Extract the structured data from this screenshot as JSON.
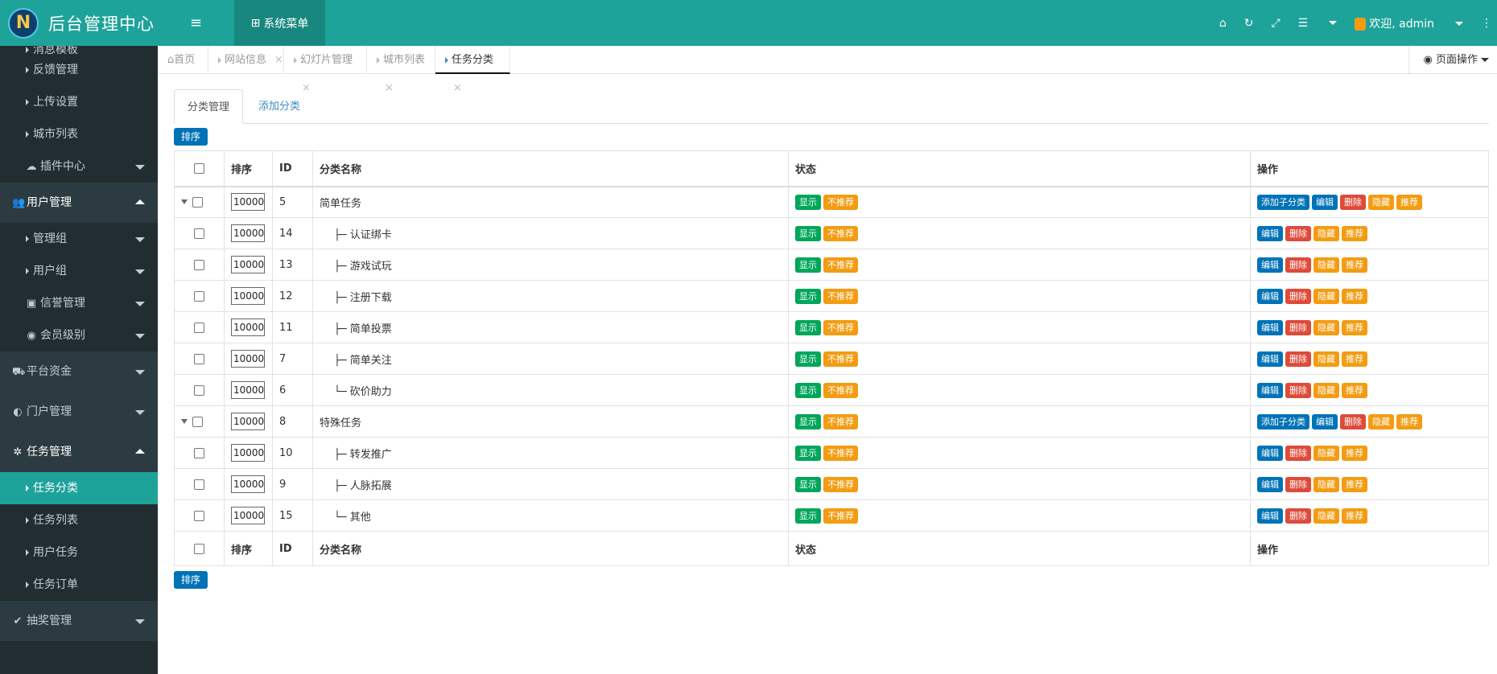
{
  "app": {
    "title": "后台管理中心",
    "logo_letter": "N"
  },
  "sidebar": {
    "items": [
      {
        "type": "sub",
        "label": "消息模板",
        "partial": true
      },
      {
        "type": "sub",
        "label": "反馈管理"
      },
      {
        "type": "sub",
        "label": "上传设置"
      },
      {
        "type": "sub",
        "label": "城市列表"
      },
      {
        "type": "sub",
        "label": "插件中心",
        "icon": "☁",
        "arrow": "down"
      },
      {
        "type": "top",
        "label": "用户管理",
        "icon": "👥",
        "arrow": "up",
        "open": true
      },
      {
        "type": "sub",
        "label": "管理组",
        "arrow": "down"
      },
      {
        "type": "sub",
        "label": "用户组",
        "arrow": "down"
      },
      {
        "type": "sub",
        "label": "信誉管理",
        "icon": "▣",
        "arrow": "down"
      },
      {
        "type": "sub",
        "label": "会员级别",
        "icon": "◉",
        "arrow": "down"
      },
      {
        "type": "top",
        "label": "平台资金",
        "icon": "⛟",
        "arrow": "down"
      },
      {
        "type": "top",
        "label": "门户管理",
        "icon": "◐",
        "arrow": "down"
      },
      {
        "type": "top",
        "label": "任务管理",
        "icon": "✲",
        "arrow": "up",
        "open": true
      },
      {
        "type": "sub",
        "label": "任务分类",
        "active": true
      },
      {
        "type": "sub",
        "label": "任务列表"
      },
      {
        "type": "sub",
        "label": "用户任务"
      },
      {
        "type": "sub",
        "label": "任务订单"
      },
      {
        "type": "top",
        "label": "抽奖管理",
        "icon": "✔",
        "arrow": "down"
      }
    ]
  },
  "header": {
    "toggle_icon": "≡",
    "system_menu": "系统菜单",
    "system_menu_icon": "⊞",
    "home_icon": "⌂",
    "refresh_icon": "↻",
    "fullscreen_icon": "⤢",
    "list_icon": "☰",
    "welcome": "欢迎, admin",
    "more_icon": "⋮"
  },
  "page_tabs": [
    {
      "label": "首页",
      "icon": "⌂",
      "closable": false
    },
    {
      "label": "网站信息",
      "closable": true
    },
    {
      "label": "幻灯片管理",
      "closable": true
    },
    {
      "label": "城市列表",
      "closable": true
    },
    {
      "label": "任务分类",
      "closable": true,
      "active": true
    }
  ],
  "page_ops": {
    "label": "页面操作",
    "icon": "◉"
  },
  "content_tabs": {
    "manage": "分类管理",
    "add": "添加分类"
  },
  "sort_button": "排序",
  "table": {
    "headers": {
      "order": "排序",
      "id": "ID",
      "name": "分类名称",
      "status": "状态",
      "ops": "操作"
    },
    "labels": {
      "show": "显示",
      "not_recommended": "不推荐",
      "add_child": "添加子分类",
      "edit": "编辑",
      "delete": "删除",
      "hide": "隐藏",
      "recommend": "推荐"
    },
    "rows": [
      {
        "order": "10000",
        "id": "5",
        "name": "简单任务",
        "prefix": "",
        "parent": true
      },
      {
        "order": "10000",
        "id": "14",
        "name": "认证绑卡",
        "prefix": "├─ ",
        "parent": false
      },
      {
        "order": "10000",
        "id": "13",
        "name": "游戏试玩",
        "prefix": "├─ ",
        "parent": false
      },
      {
        "order": "10000",
        "id": "12",
        "name": "注册下载",
        "prefix": "├─ ",
        "parent": false
      },
      {
        "order": "10000",
        "id": "11",
        "name": "简单投票",
        "prefix": "├─ ",
        "parent": false
      },
      {
        "order": "10000",
        "id": "7",
        "name": "简单关注",
        "prefix": "├─ ",
        "parent": false
      },
      {
        "order": "10000",
        "id": "6",
        "name": "砍价助力",
        "prefix": "└─ ",
        "parent": false
      },
      {
        "order": "10000",
        "id": "8",
        "name": "特殊任务",
        "prefix": "",
        "parent": true
      },
      {
        "order": "10000",
        "id": "10",
        "name": "转发推广",
        "prefix": "├─ ",
        "parent": false
      },
      {
        "order": "10000",
        "id": "9",
        "name": "人脉拓展",
        "prefix": "├─ ",
        "parent": false
      },
      {
        "order": "10000",
        "id": "15",
        "name": "其他",
        "prefix": "└─ ",
        "parent": false
      }
    ]
  }
}
